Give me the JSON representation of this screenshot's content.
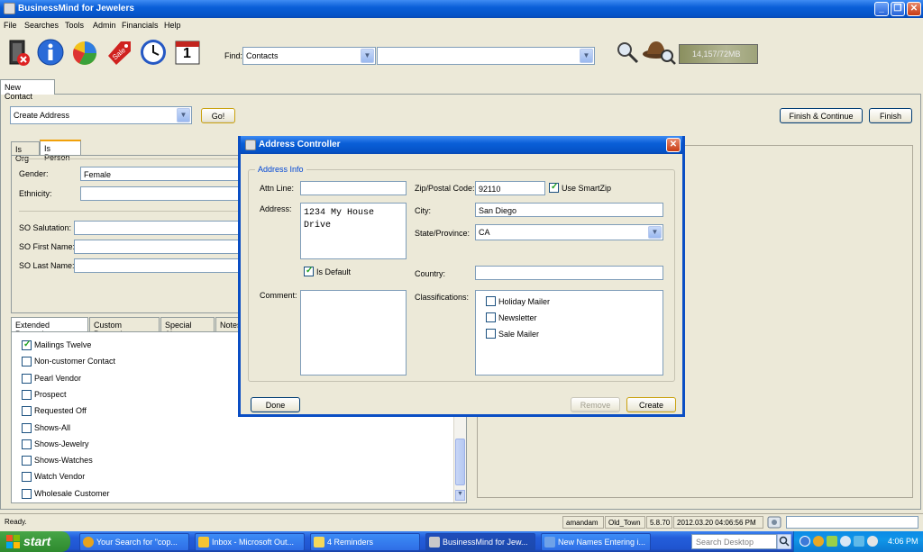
{
  "window": {
    "title": "BusinessMind for Jewelers"
  },
  "menu": [
    "File",
    "Searches",
    "Tools",
    "Admin",
    "Financials",
    "Help"
  ],
  "toolbar": {
    "icons": [
      "exit-icon",
      "info-icon",
      "pie-chart-icon",
      "sale-tag-icon",
      "clock-icon",
      "calendar-icon"
    ],
    "calendar_day": "1",
    "find_label": "Find:",
    "find_type": "Contacts",
    "find_value": "",
    "memory": "14,157/72MB"
  },
  "tabs": {
    "main": "New Contact"
  },
  "action_bar": {
    "action_select": "Create Address",
    "go": "Go!",
    "finish_continue": "Finish & Continue",
    "finish": "Finish"
  },
  "person": {
    "tabs": [
      "Is Org",
      "Is Person"
    ],
    "gender_label": "Gender:",
    "gender": "Female",
    "ethnicity_label": "Ethnicity:",
    "salutation_label": "SO Salutation:",
    "first_label": "SO First Name:",
    "last_label": "SO Last Name:"
  },
  "props": {
    "tabs": [
      "Extended Properties",
      "Custom Properties",
      "Special Alerts",
      "Notes"
    ],
    "items": [
      {
        "label": "Mailings Twelve",
        "checked": true
      },
      {
        "label": "Non-customer Contact",
        "checked": false
      },
      {
        "label": "Pearl Vendor",
        "checked": false
      },
      {
        "label": "Prospect",
        "checked": false
      },
      {
        "label": "Requested Off",
        "checked": false
      },
      {
        "label": "Shows-All",
        "checked": false
      },
      {
        "label": "Shows-Jewelry",
        "checked": false
      },
      {
        "label": "Shows-Watches",
        "checked": false
      },
      {
        "label": "Watch Vendor",
        "checked": false
      },
      {
        "label": "Wholesale Customer",
        "checked": false
      }
    ]
  },
  "dialog": {
    "title": "Address Controller",
    "group": "Address Info",
    "attn_label": "Attn Line:",
    "address_label": "Address:",
    "address_line1": "1234 My House",
    "address_line2": "Drive",
    "is_default": "Is Default",
    "comment_label": "Comment:",
    "zip_label": "Zip/Postal Code:",
    "zip": "92110",
    "smartzip": "Use SmartZip",
    "city_label": "City:",
    "city": "San Diego",
    "state_label": "State/Province:",
    "state": "CA",
    "country_label": "Country:",
    "class_label": "Classifications:",
    "classifications": [
      "Holiday Mailer",
      "Newsletter",
      "Sale Mailer"
    ],
    "done": "Done",
    "remove": "Remove",
    "create": "Create"
  },
  "status": {
    "text": "Ready.",
    "user": "amandam",
    "store": "Old_Town",
    "version": "5.8.70",
    "datetime": "2012.03.20 04:06:56 PM"
  },
  "taskbar": {
    "start": "start",
    "tasks": [
      "Your Search for \"cop...",
      "Inbox - Microsoft Out...",
      "4 Reminders",
      "BusinessMind for Jew...",
      "New Names Entering i..."
    ],
    "search_placeholder": "Search Desktop",
    "clock": "4:06 PM"
  }
}
